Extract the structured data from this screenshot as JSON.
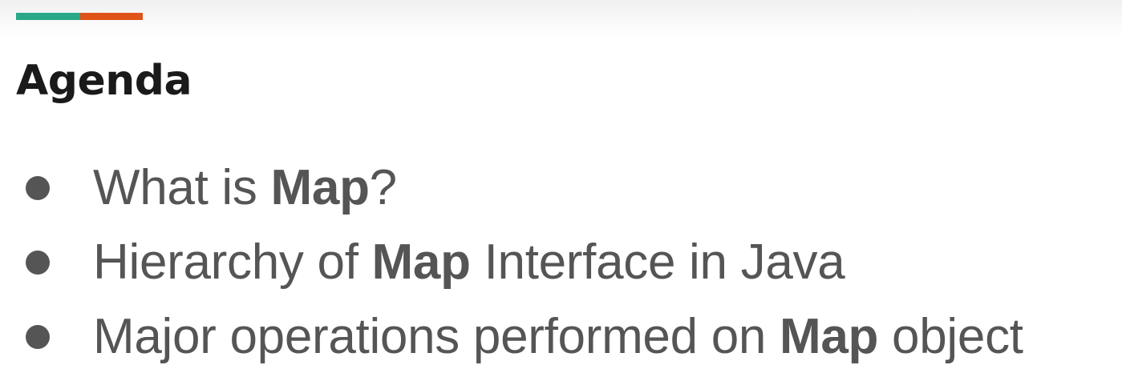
{
  "slide": {
    "title": "Agenda",
    "accent_colors": [
      "#2aa887",
      "#e0541a"
    ],
    "items": [
      {
        "before": "What is ",
        "bold": "Map",
        "after": "?"
      },
      {
        "before": "Hierarchy of ",
        "bold": "Map",
        "after": " Interface in Java"
      },
      {
        "before": "Major operations performed on ",
        "bold": "Map",
        "after": " object"
      }
    ]
  }
}
